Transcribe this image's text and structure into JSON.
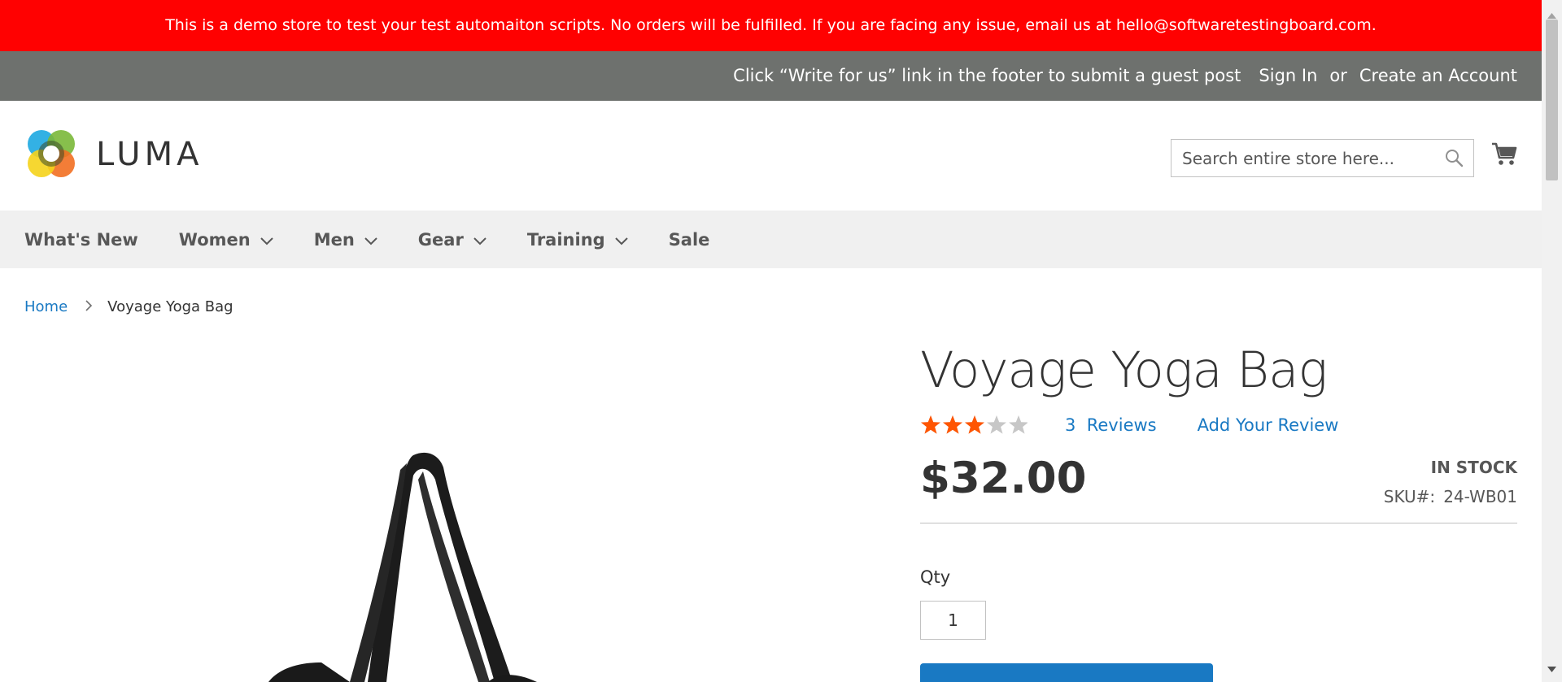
{
  "banner": {
    "text": "This is a demo store to test your test automaiton scripts. No orders will be fulfilled. If you are facing any issue, email us at hello@softwaretestingboard.com."
  },
  "top_panel": {
    "guest_post_note": "Click “Write for us” link in the footer to submit a guest post",
    "sign_in": "Sign In",
    "or": "or",
    "create_account": "Create an Account"
  },
  "header": {
    "logo_text": "LUMA",
    "search_placeholder": "Search entire store here..."
  },
  "nav": {
    "items": [
      {
        "label": "What's New",
        "has_dropdown": false
      },
      {
        "label": "Women",
        "has_dropdown": true
      },
      {
        "label": "Men",
        "has_dropdown": true
      },
      {
        "label": "Gear",
        "has_dropdown": true
      },
      {
        "label": "Training",
        "has_dropdown": true
      },
      {
        "label": "Sale",
        "has_dropdown": false
      }
    ]
  },
  "breadcrumb": {
    "home": "Home",
    "current": "Voyage Yoga Bag"
  },
  "product": {
    "title": "Voyage Yoga Bag",
    "rating_percent": 60,
    "reviews_count": "3",
    "reviews_label": "Reviews",
    "add_review": "Add Your Review",
    "price": "$32.00",
    "stock_status": "IN STOCK",
    "sku_label": "SKU#:",
    "sku_value": "24-WB01",
    "qty_label": "Qty",
    "qty_value": "1"
  },
  "colors": {
    "banner_bg": "#ff0101",
    "top_panel_bg": "#6e716e",
    "nav_bg": "#f0f0f0",
    "link": "#1979c3",
    "star_filled": "#ff5501",
    "star_empty": "#c7c7c7"
  }
}
